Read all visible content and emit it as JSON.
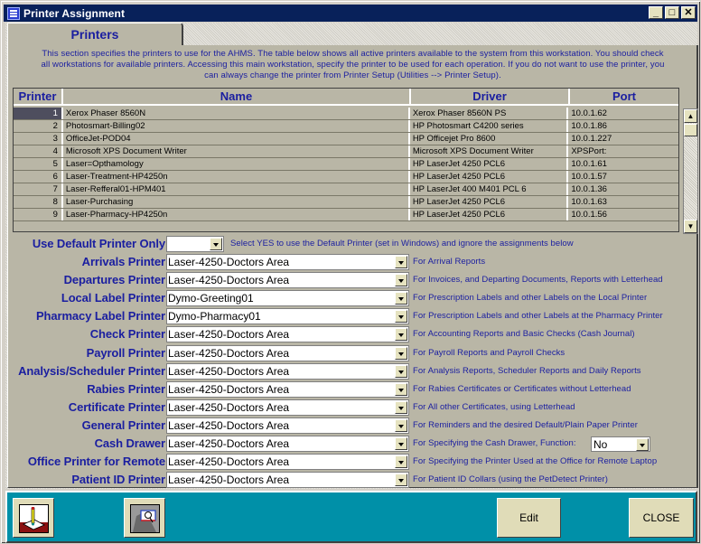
{
  "window": {
    "title": "Printer Assignment",
    "controls": {
      "minimize": "_",
      "maximize": "□",
      "close": "✕"
    }
  },
  "tabs": [
    {
      "label": "Printers",
      "active": true
    }
  ],
  "intro": {
    "line1": "This section specifies the printers to use for the AHMS.  The table below shows all active printers available to the system from this workstation.  You should check",
    "line2": "all workstations for available printers.  Accessing this main workstation, specify the printer to be used for each operation.  If you do not want to use the printer, you",
    "line3": "can always change the printer from Printer Setup (Utilities --> Printer Setup)."
  },
  "printer_table": {
    "columns": [
      "Printer",
      "Name",
      "Driver",
      "Port"
    ],
    "rows": [
      {
        "num": "1",
        "name": "Xerox Phaser 8560N",
        "driver": "Xerox Phaser 8560N PS",
        "port": "10.0.1.62",
        "selected": true
      },
      {
        "num": "2",
        "name": "Photosmart-Billing02",
        "driver": "HP Photosmart C4200 series",
        "port": "10.0.1.86"
      },
      {
        "num": "3",
        "name": "OfficeJet-POD04",
        "driver": "HP Officejet Pro 8600",
        "port": "10.0.1.227"
      },
      {
        "num": "4",
        "name": "Microsoft XPS Document Writer",
        "driver": "Microsoft XPS Document Writer",
        "port": "XPSPort:"
      },
      {
        "num": "5",
        "name": "Laser=Opthamology",
        "driver": "HP LaserJet 4250 PCL6",
        "port": "10.0.1.61"
      },
      {
        "num": "6",
        "name": "Laser-Treatment-HP4250n",
        "driver": "HP LaserJet 4250 PCL6",
        "port": "10.0.1.57"
      },
      {
        "num": "7",
        "name": "Laser-Refferal01-HPM401",
        "driver": "HP LaserJet 400 M401 PCL 6",
        "port": "10.0.1.36"
      },
      {
        "num": "8",
        "name": "Laser-Purchasing",
        "driver": "HP LaserJet 4250 PCL6",
        "port": "10.0.1.63"
      },
      {
        "num": "9",
        "name": "Laser-Pharmacy-HP4250n",
        "driver": "HP LaserJet 4250 PCL6",
        "port": "10.0.1.56"
      }
    ]
  },
  "default_printer": {
    "label": "Use Default Printer Only",
    "value": "",
    "description": "Select YES to use the Default Printer (set in Windows) and ignore the assignments below"
  },
  "assignments": [
    {
      "label": "Arrivals Printer",
      "value": "Laser-4250-Doctors Area",
      "description": "For Arrival Reports"
    },
    {
      "label": "Departures Printer",
      "value": "Laser-4250-Doctors Area",
      "description": "For Invoices, and Departing Documents, Reports with Letterhead"
    },
    {
      "label": "Local Label Printer",
      "value": "Dymo-Greeting01",
      "description": "For Prescription Labels and other Labels on the Local Printer"
    },
    {
      "label": "Pharmacy Label Printer",
      "value": "Dymo-Pharmacy01",
      "description": "For Prescription Labels and other Labels at the Pharmacy Printer"
    },
    {
      "label": "Check Printer",
      "value": "Laser-4250-Doctors Area",
      "description": "For Accounting Reports and Basic Checks (Cash Journal)"
    },
    {
      "label": "Payroll Printer",
      "value": "Laser-4250-Doctors Area",
      "description": "For Payroll Reports and Payroll Checks"
    },
    {
      "label": "Analysis/Scheduler Printer",
      "value": "Laser-4250-Doctors Area",
      "description": "For Analysis Reports, Scheduler Reports and Daily Reports"
    },
    {
      "label": "Rabies Printer",
      "value": "Laser-4250-Doctors Area",
      "description": "For Rabies Certificates or Certificates without Letterhead"
    },
    {
      "label": "Certificate Printer",
      "value": "Laser-4250-Doctors Area",
      "description": "For All other Certificates, using Letterhead"
    },
    {
      "label": "General Printer",
      "value": "Laser-4250-Doctors Area",
      "description": "For Reminders and the desired Default/Plain Paper Printer"
    },
    {
      "label": "Cash Drawer",
      "value": "Laser-4250-Doctors Area",
      "description": "For Specifying the Cash Drawer, Function:"
    },
    {
      "label": "Office Printer for Remote",
      "value": "Laser-4250-Doctors Area",
      "description": "For Specifying the Printer Used at the Office for Remote Laptop"
    },
    {
      "label": "Patient ID Printer",
      "value": "Laser-4250-Doctors Area",
      "description": "For Patient ID Collars (using the PetDetect Printer)"
    }
  ],
  "cash_drawer_function": {
    "value": "No"
  },
  "footer": {
    "icons": [
      "edit-document-icon",
      "search-magnifier-icon"
    ],
    "edit_label": "Edit",
    "close_label": "CLOSE"
  },
  "colors": {
    "titlebar": "#08215a",
    "label_blue": "#1a1ea0",
    "panel": "#b9b6a6",
    "footer": "#0090a8",
    "button": "#e0dcb8"
  }
}
